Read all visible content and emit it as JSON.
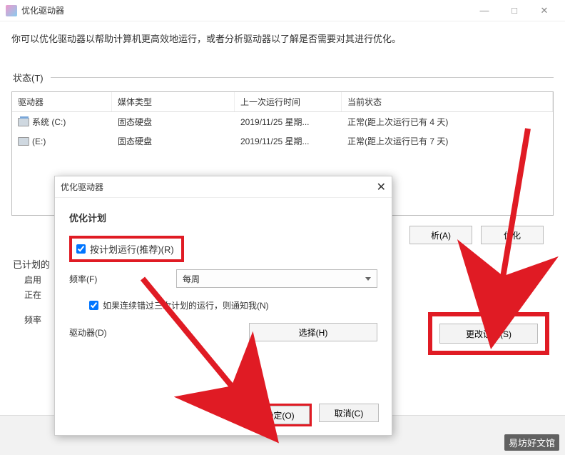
{
  "titlebar": {
    "title": "优化驱动器"
  },
  "description": "你可以优化驱动器以帮助计算机更高效地运行，或者分析驱动器以了解是否需要对其进行优化。",
  "status_label": "状态(T)",
  "table": {
    "headers": [
      "驱动器",
      "媒体类型",
      "上一次运行时间",
      "当前状态"
    ],
    "rows": [
      {
        "drive": "系统 (C:)",
        "media": "固态硬盘",
        "last": "2019/11/25 星期...",
        "state": "正常(距上次运行已有 4 天)"
      },
      {
        "drive": "(E:)",
        "media": "固态硬盘",
        "last": "2019/11/25 星期...",
        "state": "正常(距上次运行已有 7 天)"
      }
    ]
  },
  "buttons": {
    "analyze": "析(A)",
    "optimize": "优化"
  },
  "scheduled": {
    "section": "已计划的",
    "enable": "启用",
    "running": "正在",
    "freq_label": "频率"
  },
  "change_settings": "更改设置(S)",
  "dialog": {
    "title": "优化驱动器",
    "heading": "优化计划",
    "run_scheduled": "按计划运行(推荐)(R)",
    "freq_label": "频率(F)",
    "freq_value": "每周",
    "notify": "如果连续错过三次计划的运行，则通知我(N)",
    "drives_label": "驱动器(D)",
    "select_btn": "选择(H)",
    "ok": "确定(O)",
    "cancel": "取消(C)"
  },
  "watermark": "易坊好文馆"
}
